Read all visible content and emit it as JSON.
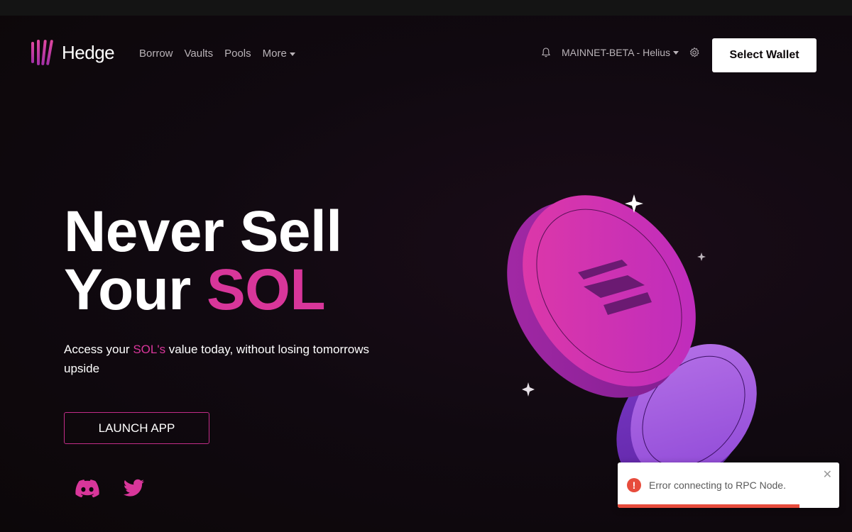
{
  "brand": {
    "name": "Hedge",
    "accent": "#d8369a"
  },
  "nav": {
    "items": [
      {
        "label": "Borrow"
      },
      {
        "label": "Vaults"
      },
      {
        "label": "Pools"
      },
      {
        "label": "More",
        "has_dropdown": true
      }
    ]
  },
  "header": {
    "notifications_icon": "bell-icon",
    "network_label": "MAINNET-BETA - Helius",
    "settings_icon": "gear-icon",
    "wallet_button": "Select Wallet"
  },
  "hero": {
    "title_line1": "Never Sell",
    "title_line2_prefix": "Your ",
    "title_line2_accent": "SOL",
    "subtitle_prefix": "Access your ",
    "subtitle_accent": "SOL's",
    "subtitle_suffix": " value today, without losing tomorrows upside",
    "launch_button": "LAUNCH APP"
  },
  "social": {
    "items": [
      {
        "icon": "discord-icon"
      },
      {
        "icon": "twitter-icon"
      }
    ]
  },
  "toast": {
    "type": "error",
    "message": "Error connecting to RPC Node.",
    "close_icon": "close-icon",
    "progress": 0.82,
    "color": "#e74c3c"
  }
}
